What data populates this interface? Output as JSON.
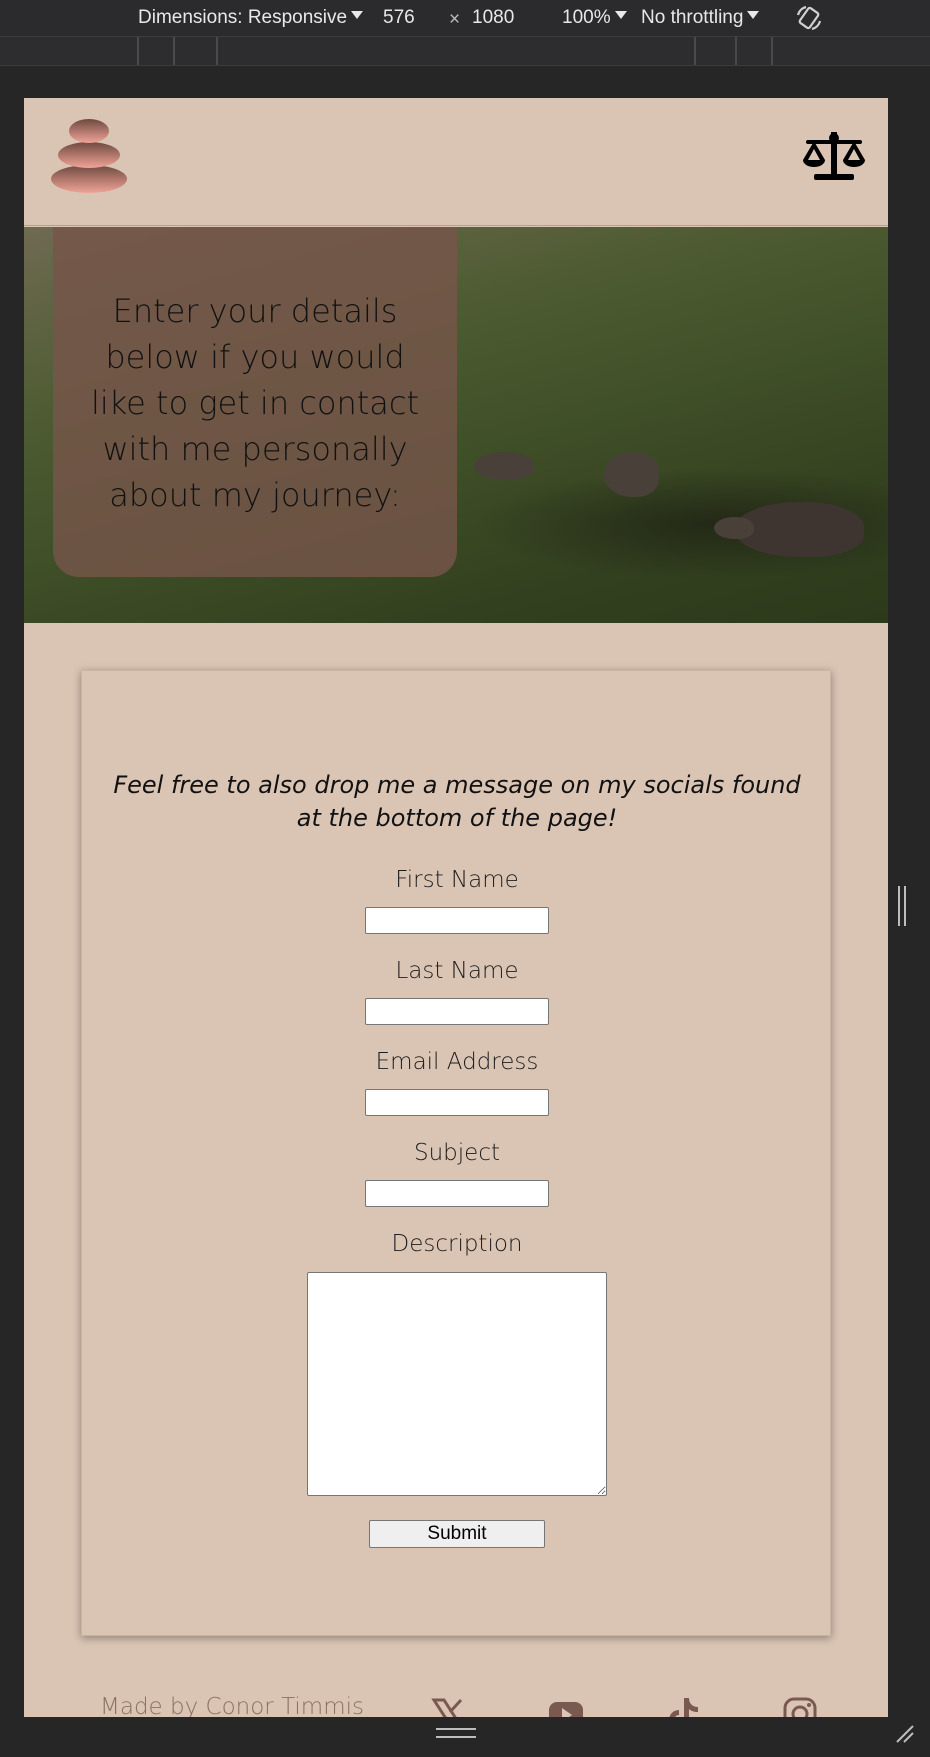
{
  "devtools": {
    "dimensions_label": "Dimensions: Responsive",
    "width_value": "576",
    "times": "×",
    "height_value": "1080",
    "zoom": "100%",
    "throttling": "No throttling"
  },
  "header": {
    "logo_icon": "stacked-stones-icon",
    "menu_icon": "balance-scale-icon"
  },
  "hero": {
    "text": "Enter your details below if you would like to get in contact with me personally about my journey:"
  },
  "form": {
    "intro": "Feel free to also drop me a message on my socials found at the bottom of the page!",
    "first_name_label": "First Name",
    "first_name_value": "",
    "last_name_label": "Last Name",
    "last_name_value": "",
    "email_label": "Email Address",
    "email_value": "",
    "subject_label": "Subject",
    "subject_value": "",
    "description_label": "Description",
    "description_value": "",
    "submit_label": "Submit"
  },
  "footer": {
    "credit": "Made by Conor Timmis",
    "socials": [
      "x-icon",
      "youtube-icon",
      "tiktok-icon",
      "instagram-icon"
    ]
  },
  "colors": {
    "page_bg": "#dac4b4",
    "hero_overlay": "#76564a",
    "footer_text": "#8c7065",
    "devtools_bg": "#2b2b2d"
  }
}
